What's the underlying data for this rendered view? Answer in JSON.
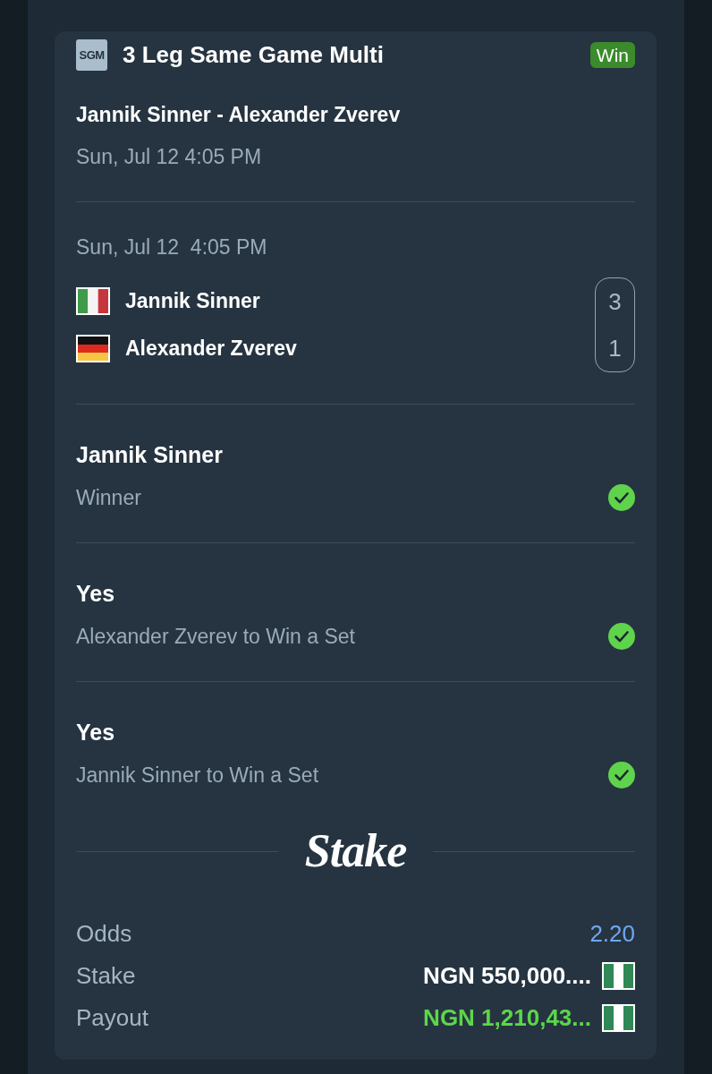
{
  "bet": {
    "tag": "SGM",
    "title": "3 Leg Same Game Multi",
    "status": "Win"
  },
  "event": {
    "name": "Jannik Sinner - Alexander Zverev",
    "date": "Sun, Jul 12 4:05 PM"
  },
  "match": {
    "date": "Sun, Jul 12  4:05 PM",
    "teams": [
      {
        "name": "Jannik Sinner",
        "score": "3"
      },
      {
        "name": "Alexander Zverev",
        "score": "1"
      }
    ]
  },
  "legs": [
    {
      "selection": "Jannik Sinner",
      "market": "Winner",
      "won": true
    },
    {
      "selection": "Yes",
      "market": "Alexander Zverev to Win a Set",
      "won": true
    },
    {
      "selection": "Yes",
      "market": "Jannik Sinner to Win a Set",
      "won": true
    }
  ],
  "brand": {
    "logo": "Stake"
  },
  "summary": [
    {
      "kind": "odds",
      "label": "Odds",
      "value": "2.20"
    },
    {
      "kind": "stake",
      "label": "Stake",
      "value": "NGN 550,000...."
    },
    {
      "kind": "payout",
      "label": "Payout",
      "value": "NGN 1,210,43..."
    }
  ]
}
